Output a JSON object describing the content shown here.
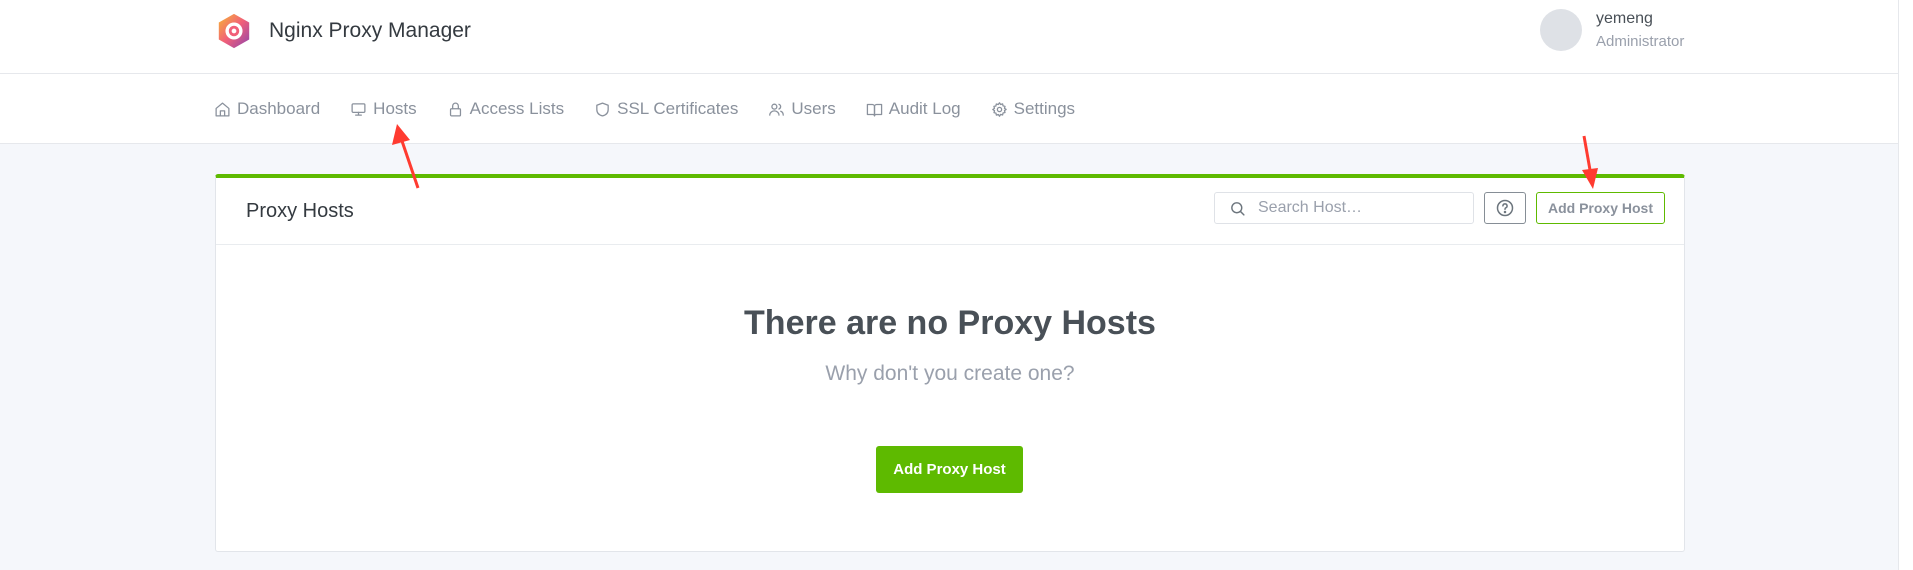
{
  "app": {
    "title": "Nginx Proxy Manager",
    "logo_icon": "npm-hexagon-logo-icon",
    "accent_color": "#5eba00"
  },
  "user": {
    "name": "yemeng",
    "role": "Administrator"
  },
  "nav": {
    "items": [
      {
        "label": "Dashboard",
        "icon": "home-icon"
      },
      {
        "label": "Hosts",
        "icon": "monitor-icon"
      },
      {
        "label": "Access Lists",
        "icon": "lock-icon"
      },
      {
        "label": "SSL Certificates",
        "icon": "shield-icon"
      },
      {
        "label": "Users",
        "icon": "users-icon"
      },
      {
        "label": "Audit Log",
        "icon": "book-icon"
      },
      {
        "label": "Settings",
        "icon": "gear-icon"
      }
    ]
  },
  "card": {
    "title": "Proxy Hosts",
    "search_placeholder": "Search Host…",
    "help_icon": "question-circle-icon",
    "add_label": "Add Proxy Host"
  },
  "empty": {
    "title": "There are no Proxy Hosts",
    "subtitle": "Why don't you create one?",
    "button_label": "Add Proxy Host"
  },
  "annotations": {
    "arrow_color": "#ff3b30"
  }
}
